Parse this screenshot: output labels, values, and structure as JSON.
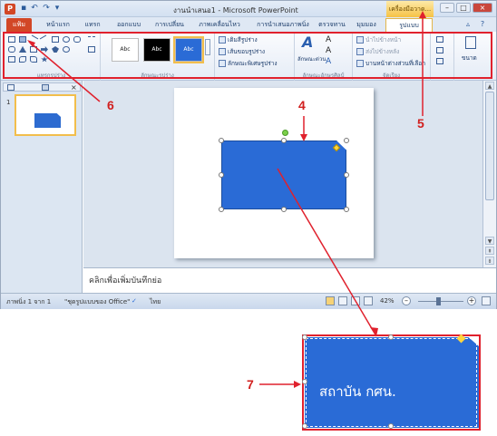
{
  "window": {
    "title": "งานนำเสนอ1 - Microsoft PowerPoint",
    "app_icon": "P",
    "drawing_tools_label": "เครื่องมือวาด..."
  },
  "tabs": [
    {
      "label": "แฟ้ม",
      "active": false
    },
    {
      "label": "หน้าแรก"
    },
    {
      "label": "แทรก"
    },
    {
      "label": "ออกแบบ"
    },
    {
      "label": "การเปลี่ยน"
    },
    {
      "label": "ภาพเคลื่อนไหว"
    },
    {
      "label": "การนำเสนอภาพนิ่ง"
    },
    {
      "label": "ตรวจทาน"
    },
    {
      "label": "มุมมอง"
    },
    {
      "label": "รูปแบบ",
      "active": true
    }
  ],
  "ribbon": {
    "group_insert_shapes": "แทรกรูปร่าง",
    "group_shape_styles": "ลักษณะรูปร่าง",
    "shape_fill": "เติมสีรูปร่าง",
    "shape_outline": "เส้นขอบรูปร่าง",
    "shape_effects": "ลักษณะพิเศษรูปร่าง",
    "style_sample": "Abc",
    "group_wordart": "ลักษณะอักษรศิลป์",
    "quick_styles": "ลักษณะด่วน",
    "group_arrange": "จัดเรียง",
    "bring_forward": "นำไปข้างหน้า",
    "send_backward": "ส่งไปข้างหลัง",
    "selection_pane": "บานหน้าต่างส่วนที่เลือก",
    "size": "ขนาด"
  },
  "slide_panel": {
    "slide_number": "1"
  },
  "notes_placeholder": "คลิกเพื่อเพิ่มบันทึกย่อ",
  "status": {
    "slide_of": "ภาพนิ่ง 1 จาก 1",
    "theme": "\"ชุดรูปแบบของ Office\"",
    "language": "ไทย",
    "zoom": "42%"
  },
  "callout": {
    "text": "สถาบัน กศน."
  },
  "annotations": [
    "4",
    "5",
    "6",
    "7"
  ],
  "colors": {
    "accent_red": "#e0212d",
    "shape_blue": "#2a6bd6",
    "file_tab": "#d24726"
  }
}
